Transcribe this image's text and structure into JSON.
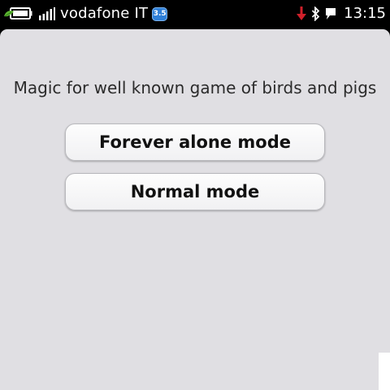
{
  "status_bar": {
    "battery_icon": "battery-charging-icon",
    "signal_icon": "signal-bars-icon",
    "operator": "vodafone IT",
    "network_badge": "3.5",
    "download_icon": "download-arrow-icon",
    "bluetooth_icon": "bluetooth-icon",
    "chat_icon": "chat-bubble-icon",
    "time": "13:15",
    "colors": {
      "background": "#000000",
      "text": "#ffffff",
      "badge": "#2e7fd8",
      "download_arrow": "#d0202a",
      "battery_leaf": "#5cb531"
    }
  },
  "main": {
    "description": "Magic for well known game of birds and pigs",
    "buttons": [
      {
        "label": "Forever alone mode"
      },
      {
        "label": "Normal mode"
      }
    ],
    "colors": {
      "panel_background": "#e0dfe3",
      "button_background": "#fbfbfc",
      "text": "#2b2b2b"
    }
  }
}
